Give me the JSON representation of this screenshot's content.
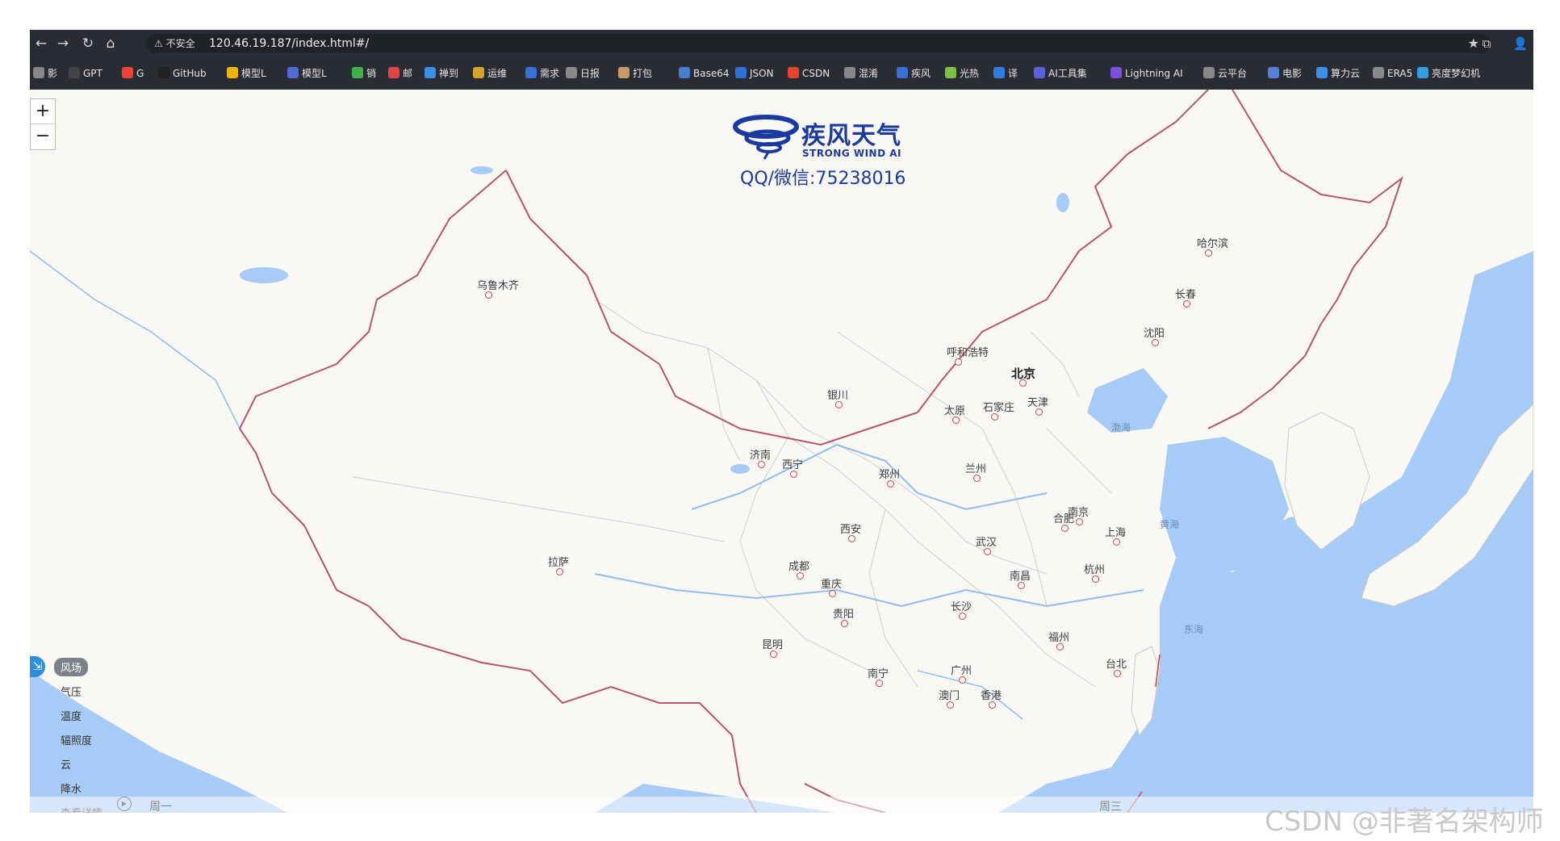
{
  "browser": {
    "nav": {
      "back": "←",
      "forward": "→",
      "reload": "↻",
      "home": "⌂"
    },
    "security_label": "⚠ 不安全",
    "url": "120.46.19.187/index.html#/",
    "star": "★",
    "extensions": "⧉",
    "profile": "👤"
  },
  "bookmarks": [
    {
      "label": "影",
      "color": "#888888"
    },
    {
      "label": "GPT",
      "color": "#444444"
    },
    {
      "label": "G",
      "color": "#ea4335"
    },
    {
      "label": "GitHub",
      "color": "#222222"
    },
    {
      "label": "模型L",
      "color": "#f2b400"
    },
    {
      "label": "模型L",
      "color": "#4f6bd6"
    },
    {
      "label": "销",
      "color": "#3bb34a"
    },
    {
      "label": "邮",
      "color": "#e04545"
    },
    {
      "label": "禅到",
      "color": "#3a8ee6"
    },
    {
      "label": "运维",
      "color": "#d4a52a"
    },
    {
      "label": "需求",
      "color": "#3a6fd6"
    },
    {
      "label": "日报",
      "color": "#888888"
    },
    {
      "label": "打包",
      "color": "#c79a6a"
    },
    {
      "label": "Base64",
      "color": "#4a7bd1"
    },
    {
      "label": "JSON",
      "color": "#2f6fd6"
    },
    {
      "label": "CSDN",
      "color": "#e5432c"
    },
    {
      "label": "混淆",
      "color": "#888888"
    },
    {
      "label": "疾风",
      "color": "#3a6fd6"
    },
    {
      "label": "光热",
      "color": "#7cc242"
    },
    {
      "label": "译",
      "color": "#2f7de1"
    },
    {
      "label": "AI工具集",
      "color": "#5a62e0"
    },
    {
      "label": "Lightning AI",
      "color": "#7b4fe0"
    },
    {
      "label": "云平台",
      "color": "#888888"
    },
    {
      "label": "电影",
      "color": "#5a7fd6"
    },
    {
      "label": "算力云",
      "color": "#3a8ee6"
    },
    {
      "label": "ERA5",
      "color": "#888888"
    },
    {
      "label": "亮度梦幻机",
      "color": "#2f9fe0"
    }
  ],
  "map": {
    "zoom_in": "+",
    "zoom_out": "−",
    "logo": {
      "cn": "疾风天气",
      "en": "STRONG WIND AI",
      "contact": "QQ/微信:75238016"
    },
    "cities": [
      {
        "name": "乌鲁木齐",
        "bold": false
      },
      {
        "name": "哈尔滨",
        "bold": false
      },
      {
        "name": "长春",
        "bold": false
      },
      {
        "name": "沈阳",
        "bold": false
      },
      {
        "name": "呼和浩特",
        "bold": false
      },
      {
        "name": "北京",
        "bold": true
      },
      {
        "name": "天津",
        "bold": false
      },
      {
        "name": "石家庄",
        "bold": false
      },
      {
        "name": "太原",
        "bold": false
      },
      {
        "name": "银川",
        "bold": false
      },
      {
        "name": "济南",
        "bold": false
      },
      {
        "name": "西宁",
        "bold": false
      },
      {
        "name": "兰州",
        "bold": false
      },
      {
        "name": "郑州",
        "bold": false
      },
      {
        "name": "西安",
        "bold": false
      },
      {
        "name": "合肥",
        "bold": false
      },
      {
        "name": "南京",
        "bold": false
      },
      {
        "name": "上海",
        "bold": false
      },
      {
        "name": "武汉",
        "bold": false
      },
      {
        "name": "拉萨",
        "bold": false
      },
      {
        "name": "成都",
        "bold": false
      },
      {
        "name": "杭州",
        "bold": false
      },
      {
        "name": "重庆",
        "bold": false
      },
      {
        "name": "南昌",
        "bold": false
      },
      {
        "name": "长沙",
        "bold": false
      },
      {
        "name": "贵阳",
        "bold": false
      },
      {
        "name": "福州",
        "bold": false
      },
      {
        "name": "昆明",
        "bold": false
      },
      {
        "name": "台北",
        "bold": false
      },
      {
        "name": "南宁",
        "bold": false
      },
      {
        "name": "广州",
        "bold": false
      },
      {
        "name": "澳门",
        "bold": false
      },
      {
        "name": "香港",
        "bold": false
      }
    ],
    "seas": [
      "渤海",
      "黄海",
      "东海"
    ],
    "layers": [
      {
        "label": "风场",
        "active": true
      },
      {
        "label": "气压",
        "active": false
      },
      {
        "label": "温度",
        "active": false
      },
      {
        "label": "辐照度",
        "active": false
      },
      {
        "label": "云",
        "active": false
      },
      {
        "label": "降水",
        "active": false
      },
      {
        "label": "查看详情",
        "active": false
      }
    ],
    "layer_icon": "⇲",
    "timeline": {
      "play": "▶",
      "days": [
        "周一",
        "周三"
      ]
    }
  },
  "watermark": "CSDN @非著名架构师",
  "colors": {
    "chrome_bg": "#292d33",
    "land": "#faf8f4",
    "sea": "#a7cbf7",
    "border": "#b5566a",
    "logo": "#1a3a9f"
  }
}
